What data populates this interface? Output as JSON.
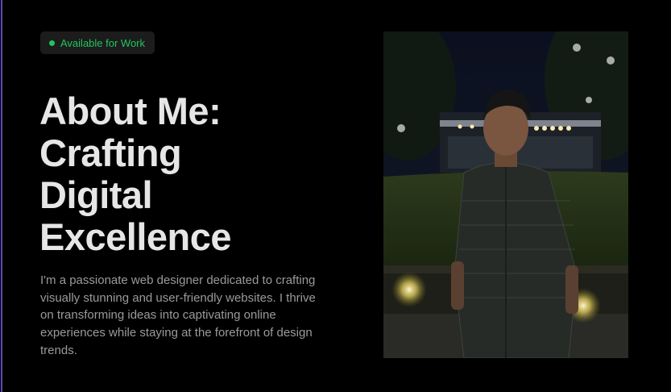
{
  "badge": {
    "label": "Available for Work",
    "status_color": "#22c55e"
  },
  "hero": {
    "heading_lines": [
      "About Me:",
      "Crafting",
      "Digital",
      "Excellence"
    ],
    "bio": "I'm  a passionate web designer dedicated to crafting visually stunning and user-friendly websites. I thrive on transforming ideas into captivating online experiences while staying at the forefront of design trends."
  },
  "photo": {
    "subject": "portrait-photo"
  },
  "colors": {
    "background": "#000000",
    "heading": "#e6e6e6",
    "body_text": "#9a9a9a",
    "accent_rule": "#5b4bb5"
  }
}
